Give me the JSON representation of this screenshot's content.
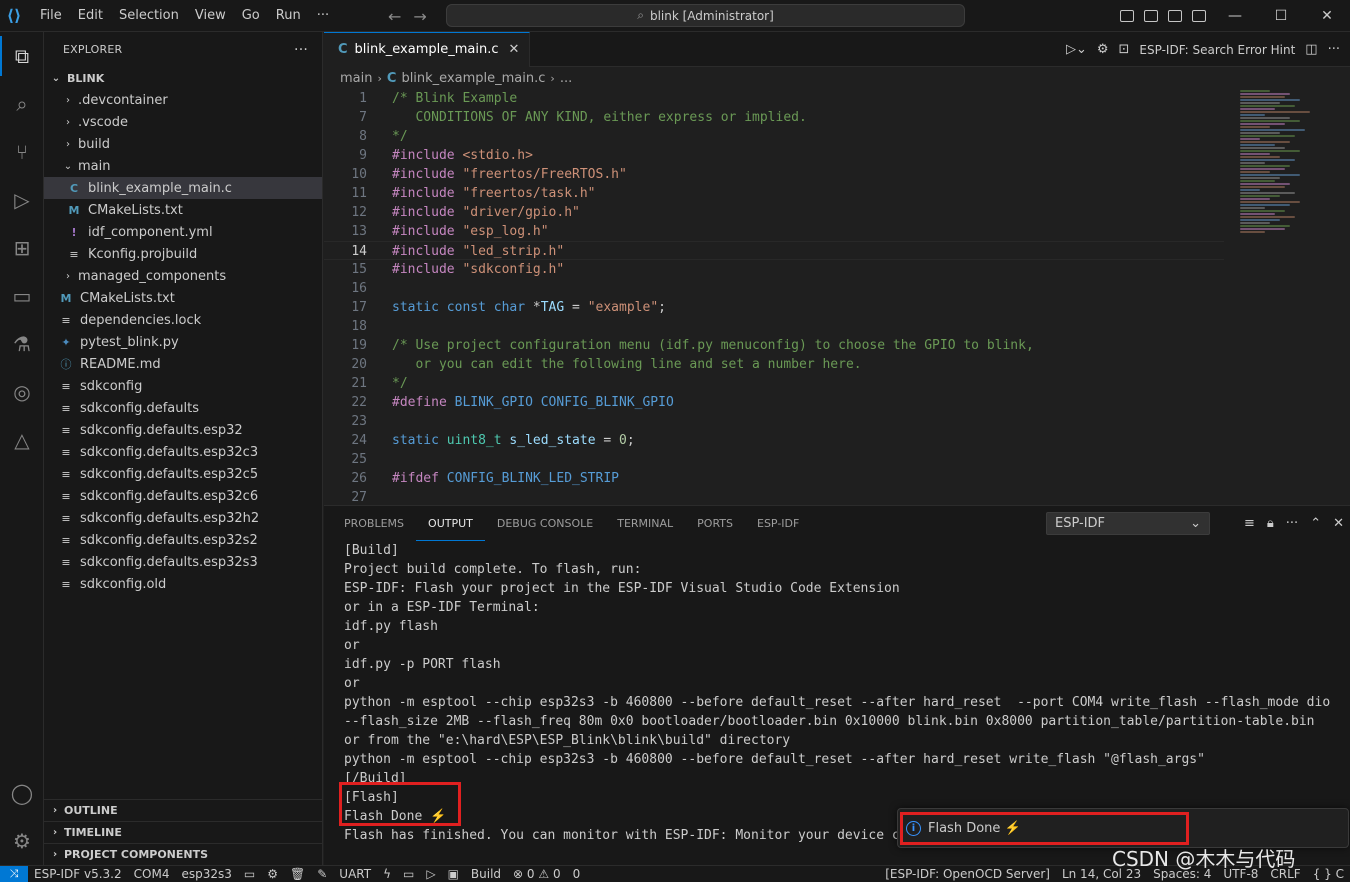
{
  "titlebar": {
    "menu": [
      "File",
      "Edit",
      "Selection",
      "View",
      "Go",
      "Run",
      "···"
    ],
    "search": "blink [Administrator]"
  },
  "explorer": {
    "header": "EXPLORER",
    "root": "BLINK",
    "items": [
      {
        "label": ".devcontainer",
        "kind": "folder"
      },
      {
        "label": ".vscode",
        "kind": "folder"
      },
      {
        "label": "build",
        "kind": "folder"
      },
      {
        "label": "main",
        "kind": "folder-open"
      },
      {
        "label": "blink_example_main.c",
        "kind": "c"
      },
      {
        "label": "CMakeLists.txt",
        "kind": "cmake"
      },
      {
        "label": "idf_component.yml",
        "kind": "yml"
      },
      {
        "label": "Kconfig.projbuild",
        "kind": "text"
      },
      {
        "label": "managed_components",
        "kind": "folder"
      },
      {
        "label": "CMakeLists.txt",
        "kind": "cmake"
      },
      {
        "label": "dependencies.lock",
        "kind": "text"
      },
      {
        "label": "pytest_blink.py",
        "kind": "py"
      },
      {
        "label": "README.md",
        "kind": "info"
      },
      {
        "label": "sdkconfig",
        "kind": "text"
      },
      {
        "label": "sdkconfig.defaults",
        "kind": "text"
      },
      {
        "label": "sdkconfig.defaults.esp32",
        "kind": "text"
      },
      {
        "label": "sdkconfig.defaults.esp32c3",
        "kind": "text"
      },
      {
        "label": "sdkconfig.defaults.esp32c5",
        "kind": "text"
      },
      {
        "label": "sdkconfig.defaults.esp32c6",
        "kind": "text"
      },
      {
        "label": "sdkconfig.defaults.esp32h2",
        "kind": "text"
      },
      {
        "label": "sdkconfig.defaults.esp32s2",
        "kind": "text"
      },
      {
        "label": "sdkconfig.defaults.esp32s3",
        "kind": "text"
      },
      {
        "label": "sdkconfig.old",
        "kind": "text"
      }
    ],
    "sections": [
      "OUTLINE",
      "TIMELINE",
      "PROJECT COMPONENTS"
    ]
  },
  "editor": {
    "tab": "blink_example_main.c",
    "action_label": "ESP-IDF: Search Error Hint",
    "breadcrumb": [
      "main",
      "blink_example_main.c",
      "..."
    ],
    "lines": [
      {
        "n": "1",
        "text": "/* Blink Example"
      },
      {
        "n": "7",
        "text": "   CONDITIONS OF ANY KIND, either express or implied."
      },
      {
        "n": "8",
        "text": "*/"
      },
      {
        "n": "9",
        "text": "#include <stdio.h>"
      },
      {
        "n": "10",
        "text": "#include \"freertos/FreeRTOS.h\""
      },
      {
        "n": "11",
        "text": "#include \"freertos/task.h\""
      },
      {
        "n": "12",
        "text": "#include \"driver/gpio.h\""
      },
      {
        "n": "13",
        "text": "#include \"esp_log.h\""
      },
      {
        "n": "14",
        "text": "#include \"led_strip.h\""
      },
      {
        "n": "15",
        "text": "#include \"sdkconfig.h\""
      },
      {
        "n": "16",
        "text": ""
      },
      {
        "n": "17",
        "text": "static const char *TAG = \"example\";"
      },
      {
        "n": "18",
        "text": ""
      },
      {
        "n": "19",
        "text": "/* Use project configuration menu (idf.py menuconfig) to choose the GPIO to blink,"
      },
      {
        "n": "20",
        "text": "   or you can edit the following line and set a number here."
      },
      {
        "n": "21",
        "text": "*/"
      },
      {
        "n": "22",
        "text": "#define BLINK_GPIO CONFIG_BLINK_GPIO"
      },
      {
        "n": "23",
        "text": ""
      },
      {
        "n": "24",
        "text": "static uint8_t s_led_state = 0;"
      },
      {
        "n": "25",
        "text": ""
      },
      {
        "n": "26",
        "text": "#ifdef CONFIG_BLINK_LED_STRIP"
      },
      {
        "n": "27",
        "text": ""
      }
    ],
    "current_line": "14"
  },
  "panel": {
    "tabs": [
      "PROBLEMS",
      "OUTPUT",
      "DEBUG CONSOLE",
      "TERMINAL",
      "PORTS",
      "ESP-IDF"
    ],
    "active_tab": "OUTPUT",
    "channel": "ESP-IDF",
    "output": [
      "[Build]",
      "Project build complete. To flash, run:",
      "ESP-IDF: Flash your project in the ESP-IDF Visual Studio Code Extension",
      "or in a ESP-IDF Terminal:",
      "idf.py flash",
      "or",
      "idf.py -p PORT flash",
      "or",
      "python -m esptool --chip esp32s3 -b 460800 --before default_reset --after hard_reset  --port COM4 write_flash --flash_mode dio",
      "--flash_size 2MB --flash_freq 80m 0x0 bootloader/bootloader.bin 0x10000 blink.bin 0x8000 partition_table/partition-table.bin",
      "or from the \"e:\\hard\\ESP\\ESP_Blink\\blink\\build\" directory",
      "python -m esptool --chip esp32s3 -b 460800 --before default_reset --after hard_reset write_flash \"@flash_args\"",
      "[/Build]",
      "[Flash]",
      "Flash Done ⚡️",
      "Flash has finished. You can monitor with ESP-IDF: Monitor your device co"
    ]
  },
  "notification": {
    "message": "Flash Done ⚡️"
  },
  "statusbar": {
    "left": [
      "ESP-IDF v5.3.2",
      "COM4",
      "esp32s3",
      "UART",
      "Build",
      "⊗ 0 ⚠ 0",
      "0"
    ],
    "right": [
      "[ESP-IDF: OpenOCD Server]",
      "Ln 14, Col 23",
      "Spaces: 4",
      "UTF-8",
      "CRLF",
      "{ } C"
    ]
  },
  "watermark": "CSDN @木木与代码",
  "colors": {
    "accent": "#0078d4",
    "highlight_box": "#e02020"
  }
}
